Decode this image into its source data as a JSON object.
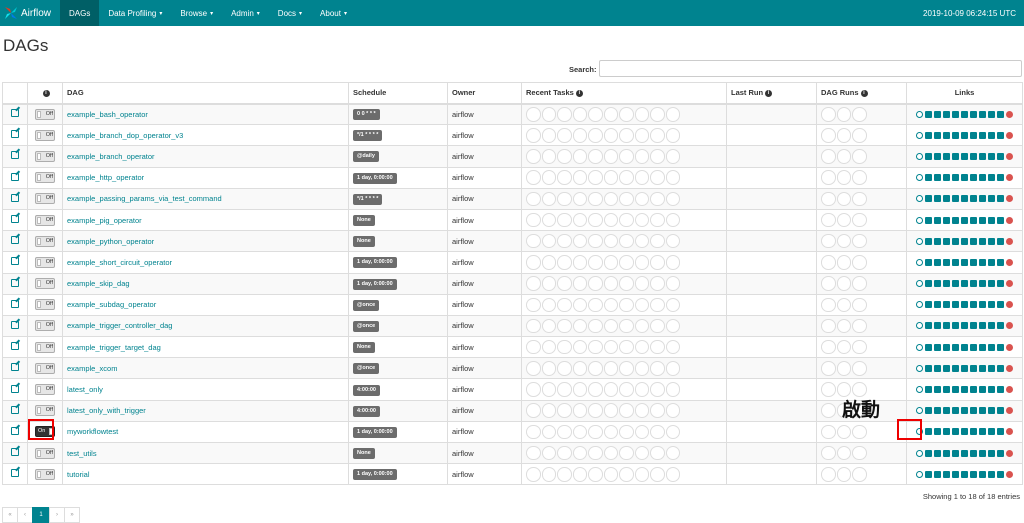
{
  "navbar": {
    "brand": "Airflow",
    "items": [
      {
        "label": "DAGs",
        "active": true,
        "dropdown": false
      },
      {
        "label": "Data Profiling",
        "dropdown": true
      },
      {
        "label": "Browse",
        "dropdown": true
      },
      {
        "label": "Admin",
        "dropdown": true
      },
      {
        "label": "Docs",
        "dropdown": true
      },
      {
        "label": "About",
        "dropdown": true
      }
    ],
    "clock": "2019-10-09 06:24:15 UTC"
  },
  "page": {
    "title": "DAGs",
    "search_label": "Search:"
  },
  "table": {
    "headers": {
      "dag": "DAG",
      "schedule": "Schedule",
      "owner": "Owner",
      "recent_tasks": "Recent Tasks",
      "last_run": "Last Run",
      "dag_runs": "DAG Runs",
      "links": "Links"
    },
    "rows": [
      {
        "dag": "example_bash_operator",
        "schedule": "0 0 * * *",
        "owner": "airflow",
        "toggle": "Off"
      },
      {
        "dag": "example_branch_dop_operator_v3",
        "schedule": "*/1 * * * *",
        "owner": "airflow",
        "toggle": "Off"
      },
      {
        "dag": "example_branch_operator",
        "schedule": "@daily",
        "owner": "airflow",
        "toggle": "Off"
      },
      {
        "dag": "example_http_operator",
        "schedule": "1 day, 0:00:00",
        "owner": "airflow",
        "toggle": "Off"
      },
      {
        "dag": "example_passing_params_via_test_command",
        "schedule": "*/1 * * * *",
        "owner": "airflow",
        "toggle": "Off"
      },
      {
        "dag": "example_pig_operator",
        "schedule": "None",
        "owner": "airflow",
        "toggle": "Off"
      },
      {
        "dag": "example_python_operator",
        "schedule": "None",
        "owner": "airflow",
        "toggle": "Off"
      },
      {
        "dag": "example_short_circuit_operator",
        "schedule": "1 day, 0:00:00",
        "owner": "airflow",
        "toggle": "Off"
      },
      {
        "dag": "example_skip_dag",
        "schedule": "1 day, 0:00:00",
        "owner": "airflow",
        "toggle": "Off"
      },
      {
        "dag": "example_subdag_operator",
        "schedule": "@once",
        "owner": "airflow",
        "toggle": "Off"
      },
      {
        "dag": "example_trigger_controller_dag",
        "schedule": "@once",
        "owner": "airflow",
        "toggle": "Off"
      },
      {
        "dag": "example_trigger_target_dag",
        "schedule": "None",
        "owner": "airflow",
        "toggle": "Off"
      },
      {
        "dag": "example_xcom",
        "schedule": "@once",
        "owner": "airflow",
        "toggle": "Off"
      },
      {
        "dag": "latest_only",
        "schedule": "4:00:00",
        "owner": "airflow",
        "toggle": "Off"
      },
      {
        "dag": "latest_only_with_trigger",
        "schedule": "4:00:00",
        "owner": "airflow",
        "toggle": "Off"
      },
      {
        "dag": "myworkflowtest",
        "schedule": "1 day, 0:00:00",
        "owner": "airflow",
        "toggle": "On"
      },
      {
        "dag": "test_utils",
        "schedule": "None",
        "owner": "airflow",
        "toggle": "Off"
      },
      {
        "dag": "tutorial",
        "schedule": "1 day, 0:00:00",
        "owner": "airflow",
        "toggle": "Off"
      }
    ]
  },
  "annotation": {
    "launch_label": "啟動"
  },
  "footer": {
    "info": "Showing 1 to 18 of 18 entries",
    "pager": [
      "«",
      "‹",
      "1",
      "›",
      "»"
    ]
  },
  "colors": {
    "navbar": "#00838f",
    "link": "#00838f",
    "delete": "#d9534f",
    "highlight_box": "#e00000"
  }
}
